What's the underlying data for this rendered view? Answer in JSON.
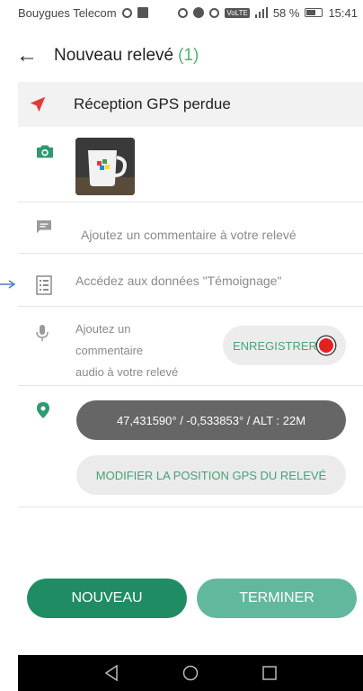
{
  "status_bar": {
    "carrier": "Bouygues Telecom",
    "battery": "58 %",
    "time": "15:41",
    "network_badge": "VoLTE"
  },
  "header": {
    "title": "Nouveau relevé",
    "count": "(1)"
  },
  "gps_status": {
    "text": "Réception GPS perdue",
    "color": "#e53935"
  },
  "photo": {
    "icon": "camera-icon"
  },
  "comment": {
    "placeholder": "Ajoutez un commentaire à votre relevé"
  },
  "testimony": {
    "text": "Accédez aux données \"Témoignage\""
  },
  "audio": {
    "label_line1": "Ajoutez un",
    "label_line2": "commentaire",
    "label_line3": "audio à votre relevé",
    "record_label": "ENREGISTRER"
  },
  "position": {
    "value": "47,431590° / -0,533853° / ALT : 22M",
    "edit_label": "MODIFIER LA POSITION GPS DU RELEVÉ"
  },
  "actions": {
    "new_label": "NOUVEAU",
    "finish_label": "TERMINER"
  },
  "colors": {
    "accent": "#49b86c",
    "primary": "#1f8c63",
    "secondary": "#62b89e",
    "record": "#e52020"
  }
}
